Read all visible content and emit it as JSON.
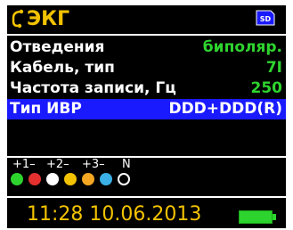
{
  "header": {
    "title": "ЭКГ",
    "icon": "ecg-leads-icon",
    "storage_icon": "sd-card-icon",
    "storage_label": "SD"
  },
  "settings": [
    {
      "label": "Отведения",
      "value": "биполяр.",
      "selected": false
    },
    {
      "label": "Кабель, тип",
      "value": "7I",
      "selected": false
    },
    {
      "label": "Частота записи, Гц",
      "value": "250",
      "selected": false
    },
    {
      "label": "Тип ИВР",
      "value": "DDD+DDD(R)",
      "selected": true
    }
  ],
  "lead_labels": [
    "+1–",
    "+2–",
    "+3–",
    "N"
  ],
  "electrodes": [
    {
      "color": "#2ed42e"
    },
    {
      "color": "#e53030"
    },
    {
      "color": "#ffffff"
    },
    {
      "color": "#f2c200"
    },
    {
      "color": "#f5a623"
    },
    {
      "color": "#3ab0e6"
    },
    {
      "color": "#000000",
      "outline": "#ffffff"
    }
  ],
  "footer": {
    "datetime": "11:28 10.06.2013",
    "battery_icon": "battery-full-icon",
    "battery_level": 1.0
  },
  "colors": {
    "title": "#f2c200",
    "value": "#2ed42e",
    "selection": "#1a1aff"
  }
}
